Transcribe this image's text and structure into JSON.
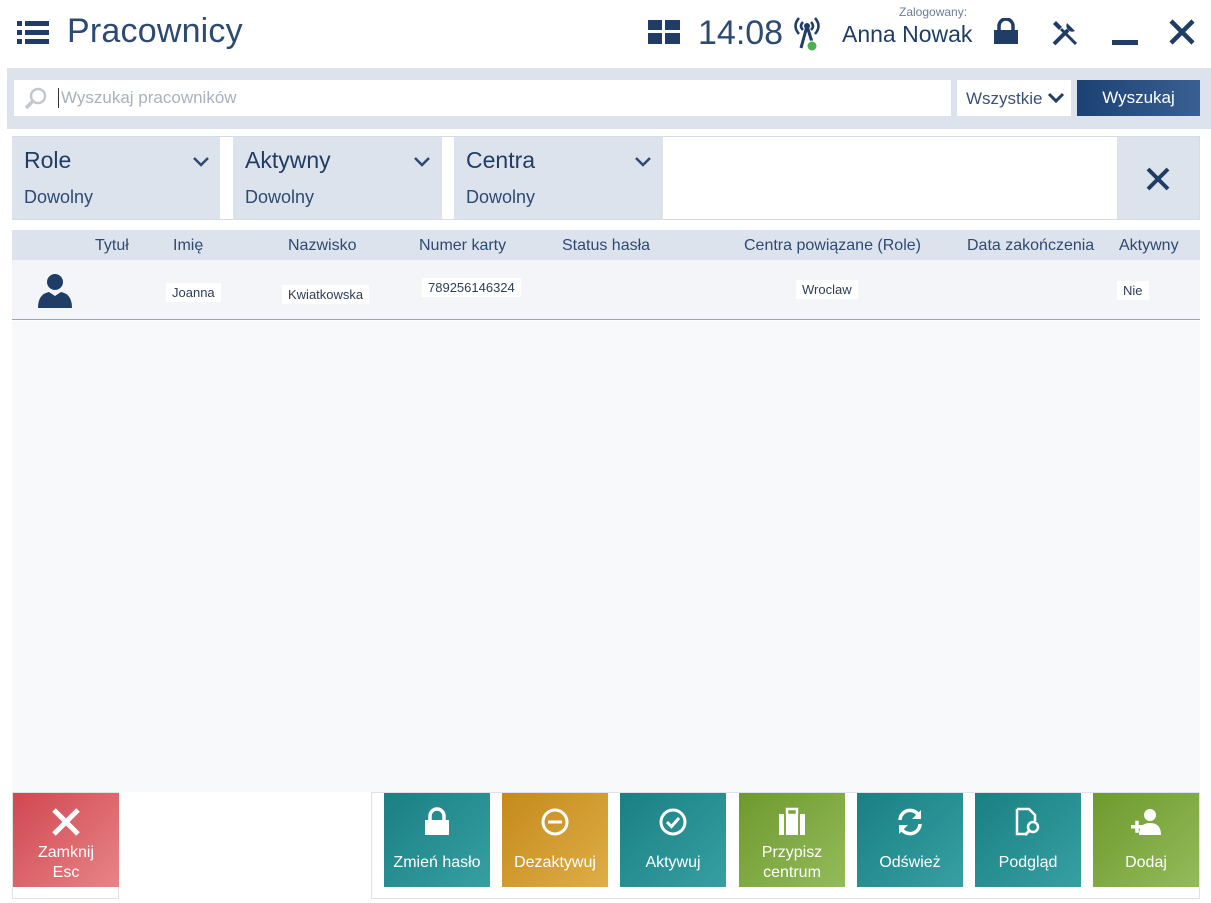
{
  "header": {
    "title": "Pracownicy",
    "time": "14:08",
    "login_label": "Zalogowany:",
    "user_name": "Anna Nowak",
    "icons": [
      "list-menu-icon",
      "tiles-icon",
      "signal-icon",
      "lock-icon",
      "tools-icon",
      "minimize-icon",
      "close-icon"
    ]
  },
  "search": {
    "placeholder": "Wyszukaj pracowników",
    "value": "",
    "scope_selected": "Wszystkie",
    "button_label": "Wyszukaj"
  },
  "filters": [
    {
      "title": "Role",
      "value": "Dowolny"
    },
    {
      "title": "Aktywny",
      "value": "Dowolny"
    },
    {
      "title": "Centra",
      "value": "Dowolny"
    }
  ],
  "table": {
    "columns": [
      "Tytuł",
      "Imię",
      "Nazwisko",
      "Numer karty",
      "Status hasła",
      "Centra powiązane (Role)",
      "Data zakończenia",
      "Aktywny"
    ],
    "rows": [
      {
        "title": "",
        "first_name": "Joanna",
        "last_name": "Kwiatkowska",
        "card_number": "789256146324",
        "password_status": "",
        "centers": "Wroclaw",
        "end_date": "",
        "active": "Nie"
      }
    ]
  },
  "footer": {
    "close": {
      "label": "Zamknij",
      "shortcut": "Esc"
    },
    "actions": [
      {
        "id": "change-password",
        "label": "Zmień hasło",
        "icon": "lock-icon"
      },
      {
        "id": "deactivate",
        "label": "Dezaktywuj",
        "icon": "minus-circle-icon"
      },
      {
        "id": "activate",
        "label": "Aktywuj",
        "icon": "check-circle-icon"
      },
      {
        "id": "assign-center",
        "label": "Przypisz centrum",
        "icon": "briefcase-icon"
      },
      {
        "id": "refresh",
        "label": "Odśwież",
        "icon": "refresh-icon"
      },
      {
        "id": "preview",
        "label": "Podgląd",
        "icon": "document-search-icon"
      },
      {
        "id": "add",
        "label": "Dodaj",
        "icon": "add-user-icon"
      }
    ]
  },
  "colors": {
    "primary": "#1f3d66",
    "panel": "#dde3ec",
    "teal": "#1b7f83",
    "ochre": "#c48a1c",
    "green": "#6d9a2e",
    "red": "#d04850",
    "status_dot": "#4caf50"
  }
}
